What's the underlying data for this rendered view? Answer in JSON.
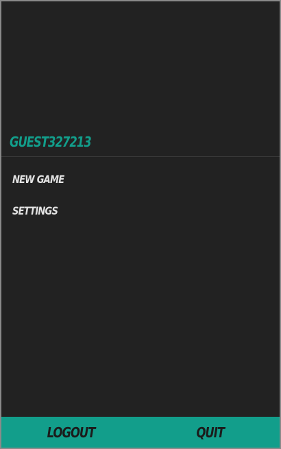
{
  "header": {
    "username": "GUEST327213"
  },
  "menu": {
    "items": [
      {
        "label": "NEW GAME"
      },
      {
        "label": "SETTINGS"
      }
    ]
  },
  "footer": {
    "logout_label": "LOGOUT",
    "quit_label": "QUIT"
  },
  "colors": {
    "accent": "#129e8b",
    "background": "#222222",
    "menu_text": "#e2e2e2",
    "button_text": "#1b1b1b"
  }
}
